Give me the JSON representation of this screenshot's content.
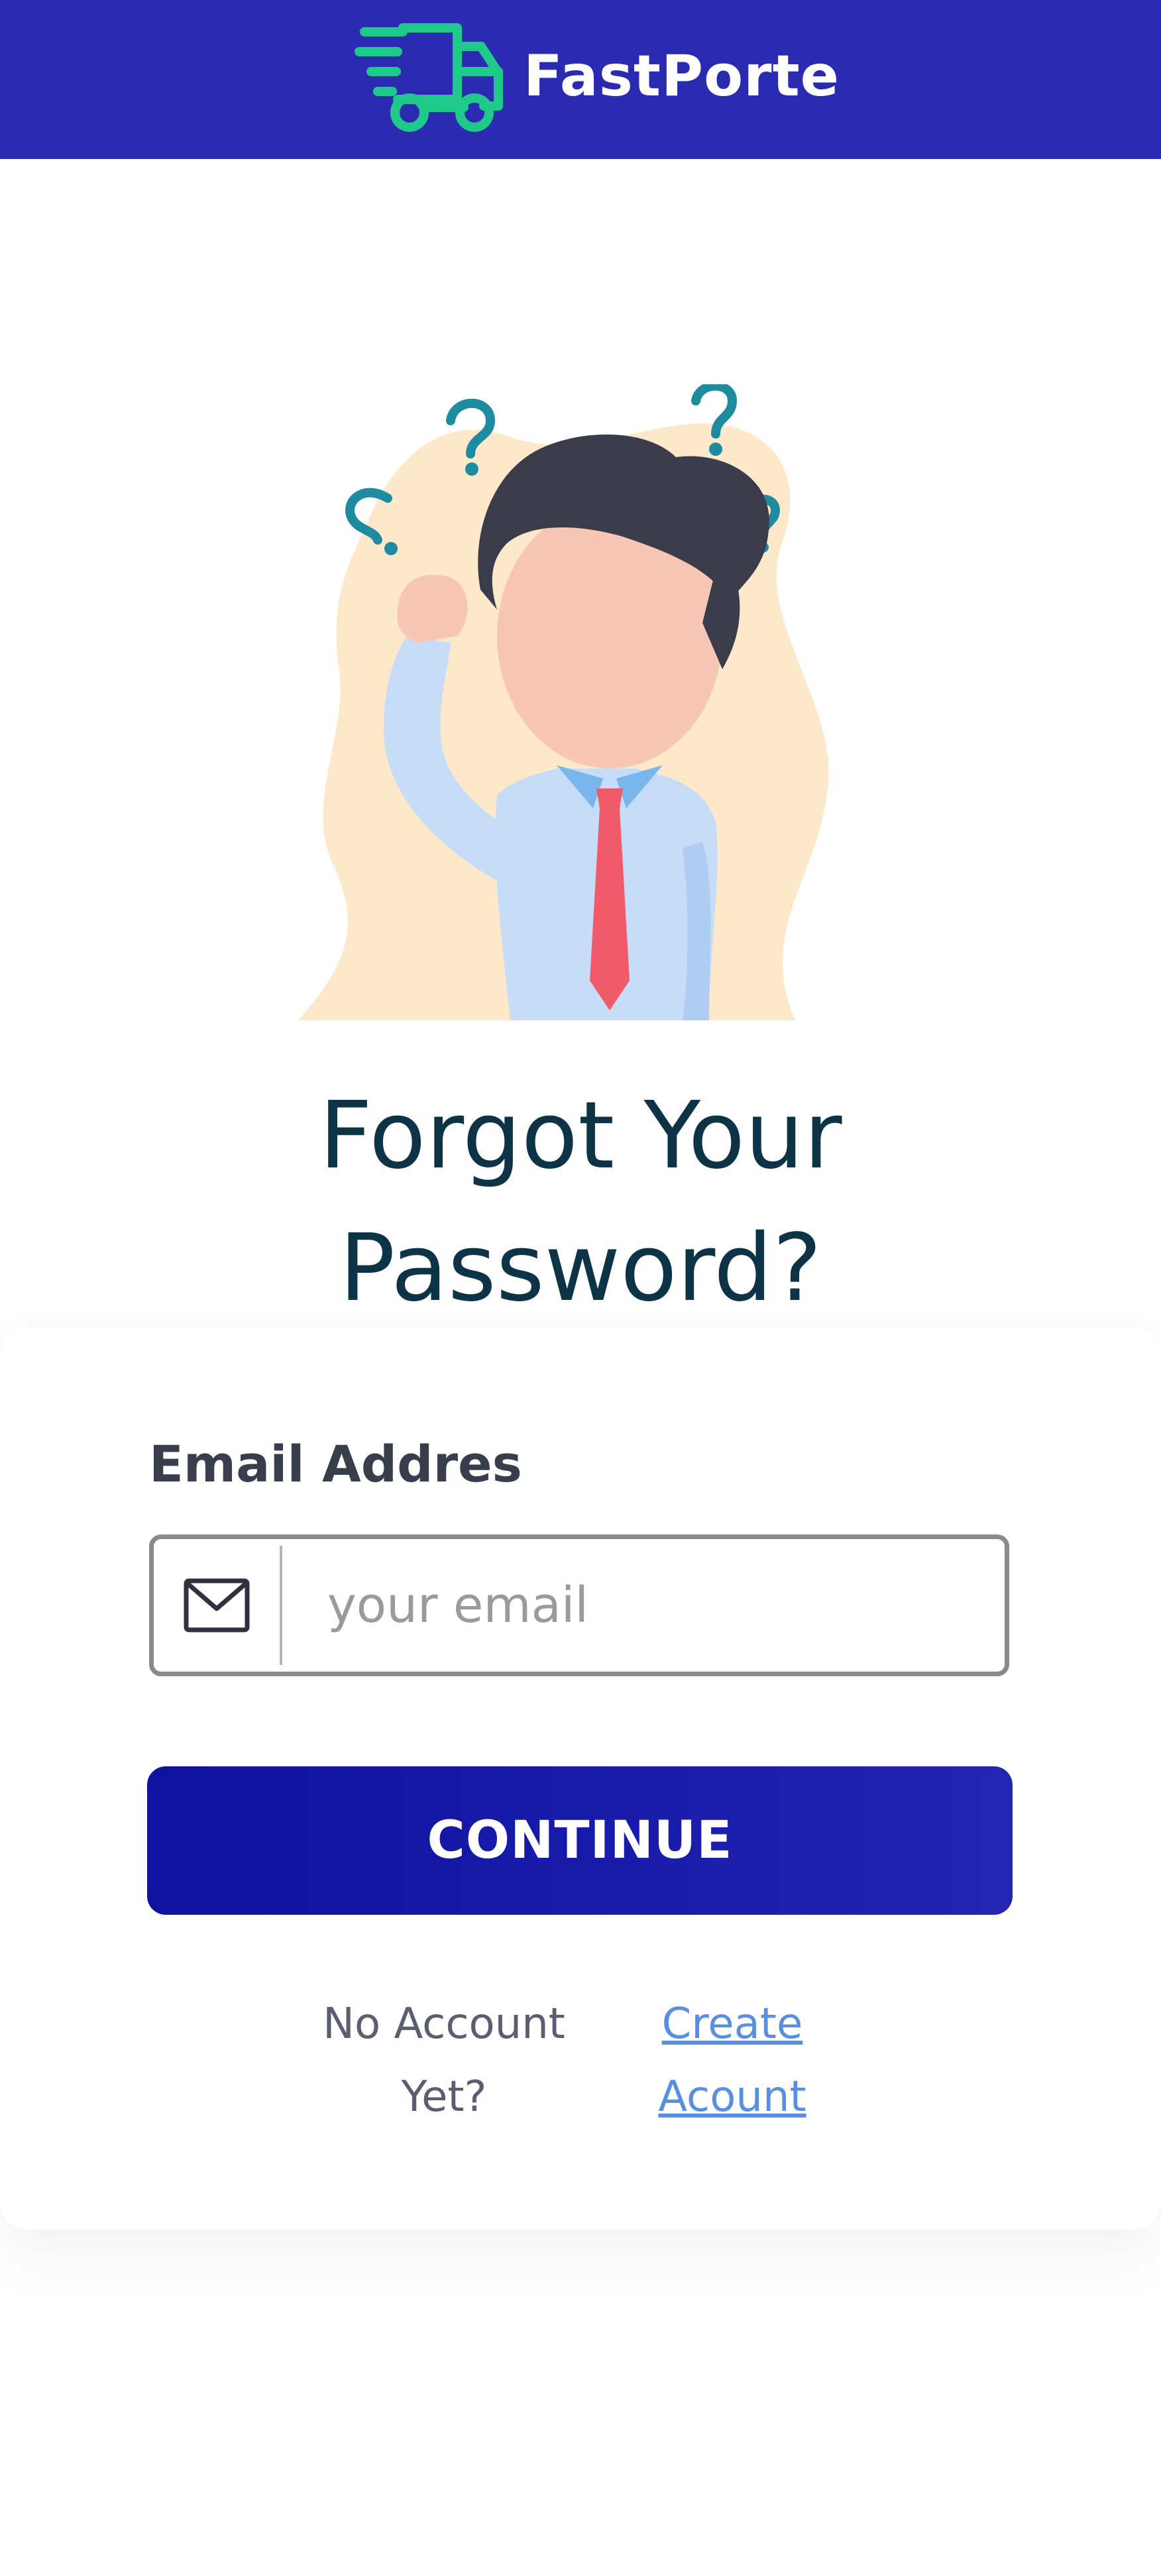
{
  "header": {
    "brand_name": "FastPorte",
    "logo_icon": "delivery-truck-icon",
    "background_color": "#2a2bb0",
    "logo_color": "#1fc98a"
  },
  "illustration": {
    "icon": "confused-person-illustration"
  },
  "page": {
    "title_line1": "Forgot Your",
    "title_line2": "Password?"
  },
  "form": {
    "email_label": "Email Addres",
    "email_placeholder": "your email",
    "email_value": "",
    "email_icon": "envelope-icon",
    "continue_label": "CONTINUE"
  },
  "footer": {
    "no_account_line1": "No Account",
    "no_account_line2": "Yet?",
    "create_line1": "Create",
    "create_line2": "Acount",
    "link_color": "#5a8fe0"
  }
}
